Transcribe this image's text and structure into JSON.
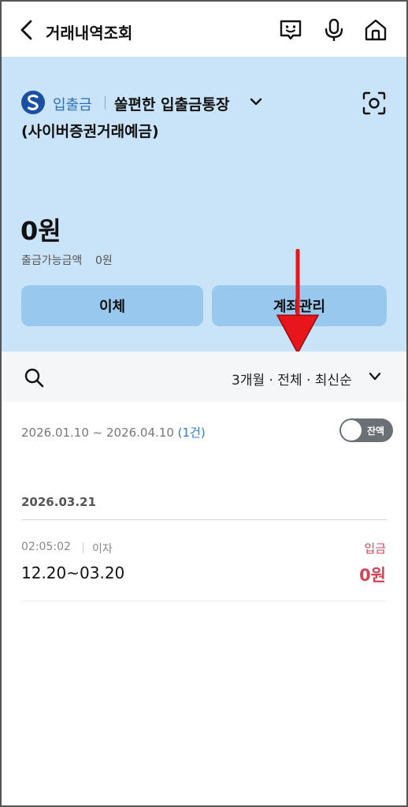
{
  "header": {
    "title": "거래내역조회",
    "icons": [
      "back-arrow-icon",
      "chatbot-icon",
      "microphone-icon",
      "home-icon"
    ]
  },
  "account": {
    "logo_icon": "shinhan-logo-icon",
    "type": "입출금",
    "name": "쏠편한 입출금통장",
    "subtitle": "(사이버증권거래예금)",
    "balance": "0원",
    "available_label": "출금가능금액",
    "available_value": "0원",
    "transfer_button": "이체",
    "manage_button": "계좌관리",
    "colors": {
      "card_bg": "#c9e3f8",
      "button_bg": "#98c8ee",
      "arrow": "#e8151b"
    }
  },
  "filter": {
    "summary": "3개월 · 전체 · 최신순",
    "search_icon": "search-icon"
  },
  "history": {
    "range": "2026.01.10 ~ 2026.04.10",
    "count": "(1건)",
    "toggle_label": "잔액",
    "toggle_on": false,
    "groups": [
      {
        "date": "2026.03.21",
        "items": [
          {
            "time": "02:05:02",
            "kind": "이자",
            "memo": "12.20~03.20",
            "type": "입금",
            "amount": "0원"
          }
        ]
      }
    ],
    "colors": {
      "deposit": "#d24457",
      "count_link": "#2d7ad0"
    }
  }
}
